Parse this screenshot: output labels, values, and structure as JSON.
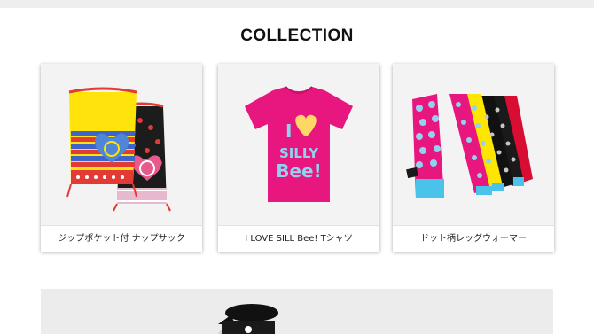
{
  "section": {
    "title": "COLLECTION"
  },
  "products": [
    {
      "name": "ジップポケット付 ナップサック",
      "image": "knapsack-bags-photo"
    },
    {
      "name": "I LOVE SILL Bee! Tシャツ",
      "image": "pink-tshirt-photo",
      "print_lines": [
        "I",
        "SILLY",
        "Bee!"
      ]
    },
    {
      "name": "ドット柄レッグウォーマー",
      "image": "dotted-leg-warmers-photo"
    }
  ],
  "colors": {
    "title": "#111111",
    "tshirt": "#e8177f",
    "tshirt_print": "#8fd3ef",
    "heart": "#ffd766",
    "bag_yellow": "#ffe30a",
    "bag_red": "#e43a36"
  }
}
